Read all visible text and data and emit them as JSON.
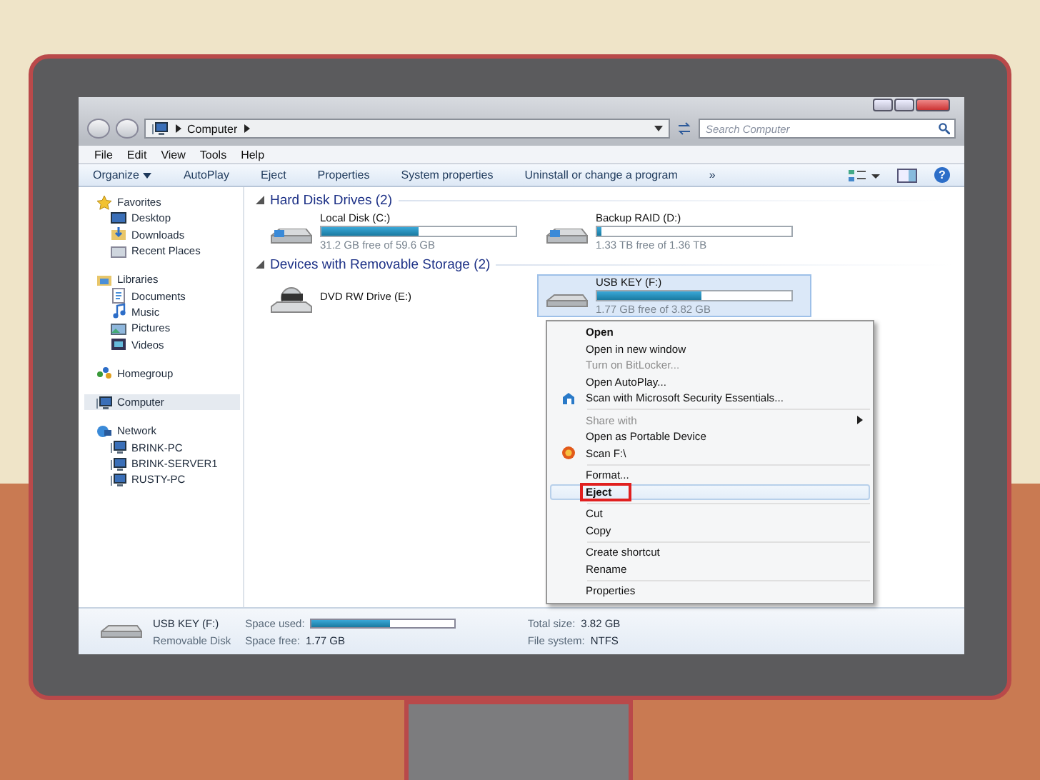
{
  "address": {
    "path": "Computer"
  },
  "search": {
    "placeholder": "Search Computer"
  },
  "menu_bar": [
    "File",
    "Edit",
    "View",
    "Tools",
    "Help"
  ],
  "toolbar": [
    {
      "label": "Organize",
      "dropdown": true
    },
    {
      "label": "AutoPlay",
      "dropdown": false
    },
    {
      "label": "Eject",
      "dropdown": false
    },
    {
      "label": "Properties",
      "dropdown": false
    },
    {
      "label": "System properties",
      "dropdown": false
    },
    {
      "label": "Uninstall or change a program",
      "dropdown": false
    },
    {
      "label": "»",
      "dropdown": false
    }
  ],
  "help_button": "?",
  "sidebar": {
    "groups": [
      {
        "label": "Favorites",
        "kind": "favorites",
        "selected": false,
        "children": [
          {
            "label": "Desktop",
            "kind": "desktop",
            "selected": false
          },
          {
            "label": "Downloads",
            "kind": "downloads",
            "selected": false
          },
          {
            "label": "Recent Places",
            "kind": "recent",
            "selected": false
          }
        ]
      },
      {
        "label": "Libraries",
        "kind": "libraries",
        "selected": false,
        "children": [
          {
            "label": "Documents",
            "kind": "documents",
            "selected": false
          },
          {
            "label": "Music",
            "kind": "music",
            "selected": false
          },
          {
            "label": "Pictures",
            "kind": "pictures",
            "selected": false
          },
          {
            "label": "Videos",
            "kind": "videos",
            "selected": false
          }
        ]
      },
      {
        "label": "Homegroup",
        "kind": "homegroup",
        "selected": false
      },
      {
        "label": "Computer",
        "kind": "computer",
        "selected": true
      },
      {
        "label": "Network",
        "kind": "network",
        "selected": false,
        "children": [
          {
            "label": "BRINK-PC",
            "kind": "computer",
            "selected": false
          },
          {
            "label": "BRINK-SERVER1",
            "kind": "computer",
            "selected": false
          },
          {
            "label": "RUSTY-PC",
            "kind": "computer",
            "selected": false
          }
        ]
      }
    ]
  },
  "sections": [
    {
      "title": "Hard Disk Drives (2)",
      "expanded": true,
      "drives": [
        {
          "kind": "hdd",
          "name": "Local Disk (C:)",
          "level": 0.5,
          "free": "31.2 GB free of 59.6 GB",
          "selected": false
        },
        {
          "kind": "hdd",
          "name": "Backup RAID (D:)",
          "level": 0.02,
          "free": "1.33 TB free of 1.36 TB",
          "selected": false
        }
      ]
    },
    {
      "title": "Devices with Removable Storage (2)",
      "expanded": true,
      "drives": [
        {
          "kind": "dvd",
          "name": "DVD RW Drive (E:)",
          "selected": false
        },
        {
          "kind": "usb",
          "name": "USB KEY (F:)",
          "level": 0.54,
          "free": "1.77 GB free of 3.82 GB",
          "selected": true
        }
      ]
    }
  ],
  "context_menu": {
    "items": [
      {
        "kind": "text",
        "label": "Open",
        "default": true,
        "disabled": false,
        "selected": false,
        "submenu": false
      },
      {
        "kind": "text",
        "label": "Open in new window",
        "default": false,
        "disabled": false,
        "selected": false,
        "submenu": false
      },
      {
        "kind": "text",
        "label": "Turn on BitLocker...",
        "default": false,
        "disabled": true,
        "selected": false,
        "submenu": false
      },
      {
        "kind": "text",
        "label": "Open AutoPlay...",
        "default": false,
        "disabled": false,
        "selected": false,
        "submenu": false
      },
      {
        "kind": "security",
        "label": "Scan with Microsoft Security Essentials...",
        "default": false,
        "disabled": false,
        "selected": false,
        "submenu": false
      },
      {
        "kind": "separator"
      },
      {
        "kind": "text",
        "label": "Share with",
        "default": false,
        "disabled": true,
        "selected": false,
        "submenu": true
      },
      {
        "kind": "text",
        "label": "Open as Portable Device",
        "default": false,
        "disabled": false,
        "selected": false,
        "submenu": false
      },
      {
        "kind": "scan",
        "label": "Scan F:\\",
        "default": false,
        "disabled": false,
        "selected": false,
        "submenu": false
      },
      {
        "kind": "separator"
      },
      {
        "kind": "text",
        "label": "Format...",
        "default": false,
        "disabled": false,
        "selected": false,
        "submenu": false
      },
      {
        "kind": "text",
        "label": "Eject",
        "default": false,
        "disabled": false,
        "selected": true,
        "submenu": false
      },
      {
        "kind": "separator"
      },
      {
        "kind": "text",
        "label": "Cut",
        "default": false,
        "disabled": false,
        "selected": false,
        "submenu": false
      },
      {
        "kind": "text",
        "label": "Copy",
        "default": false,
        "disabled": false,
        "selected": false,
        "submenu": false
      },
      {
        "kind": "separator"
      },
      {
        "kind": "text",
        "label": "Create shortcut",
        "default": false,
        "disabled": false,
        "selected": false,
        "submenu": false
      },
      {
        "kind": "text",
        "label": "Rename",
        "default": false,
        "disabled": false,
        "selected": false,
        "submenu": false
      },
      {
        "kind": "separator"
      },
      {
        "kind": "text",
        "label": "Properties",
        "default": false,
        "disabled": false,
        "selected": false,
        "submenu": false
      }
    ]
  },
  "details_pane": {
    "name": "USB KEY (F:)",
    "type": "Removable Disk",
    "used_label": "Space used:",
    "level": 0.55,
    "free_label": "Space free:",
    "free": "1.77 GB",
    "total_label": "Total size:",
    "total": "3.82 GB",
    "fs_label": "File system:",
    "fs": "NTFS"
  }
}
